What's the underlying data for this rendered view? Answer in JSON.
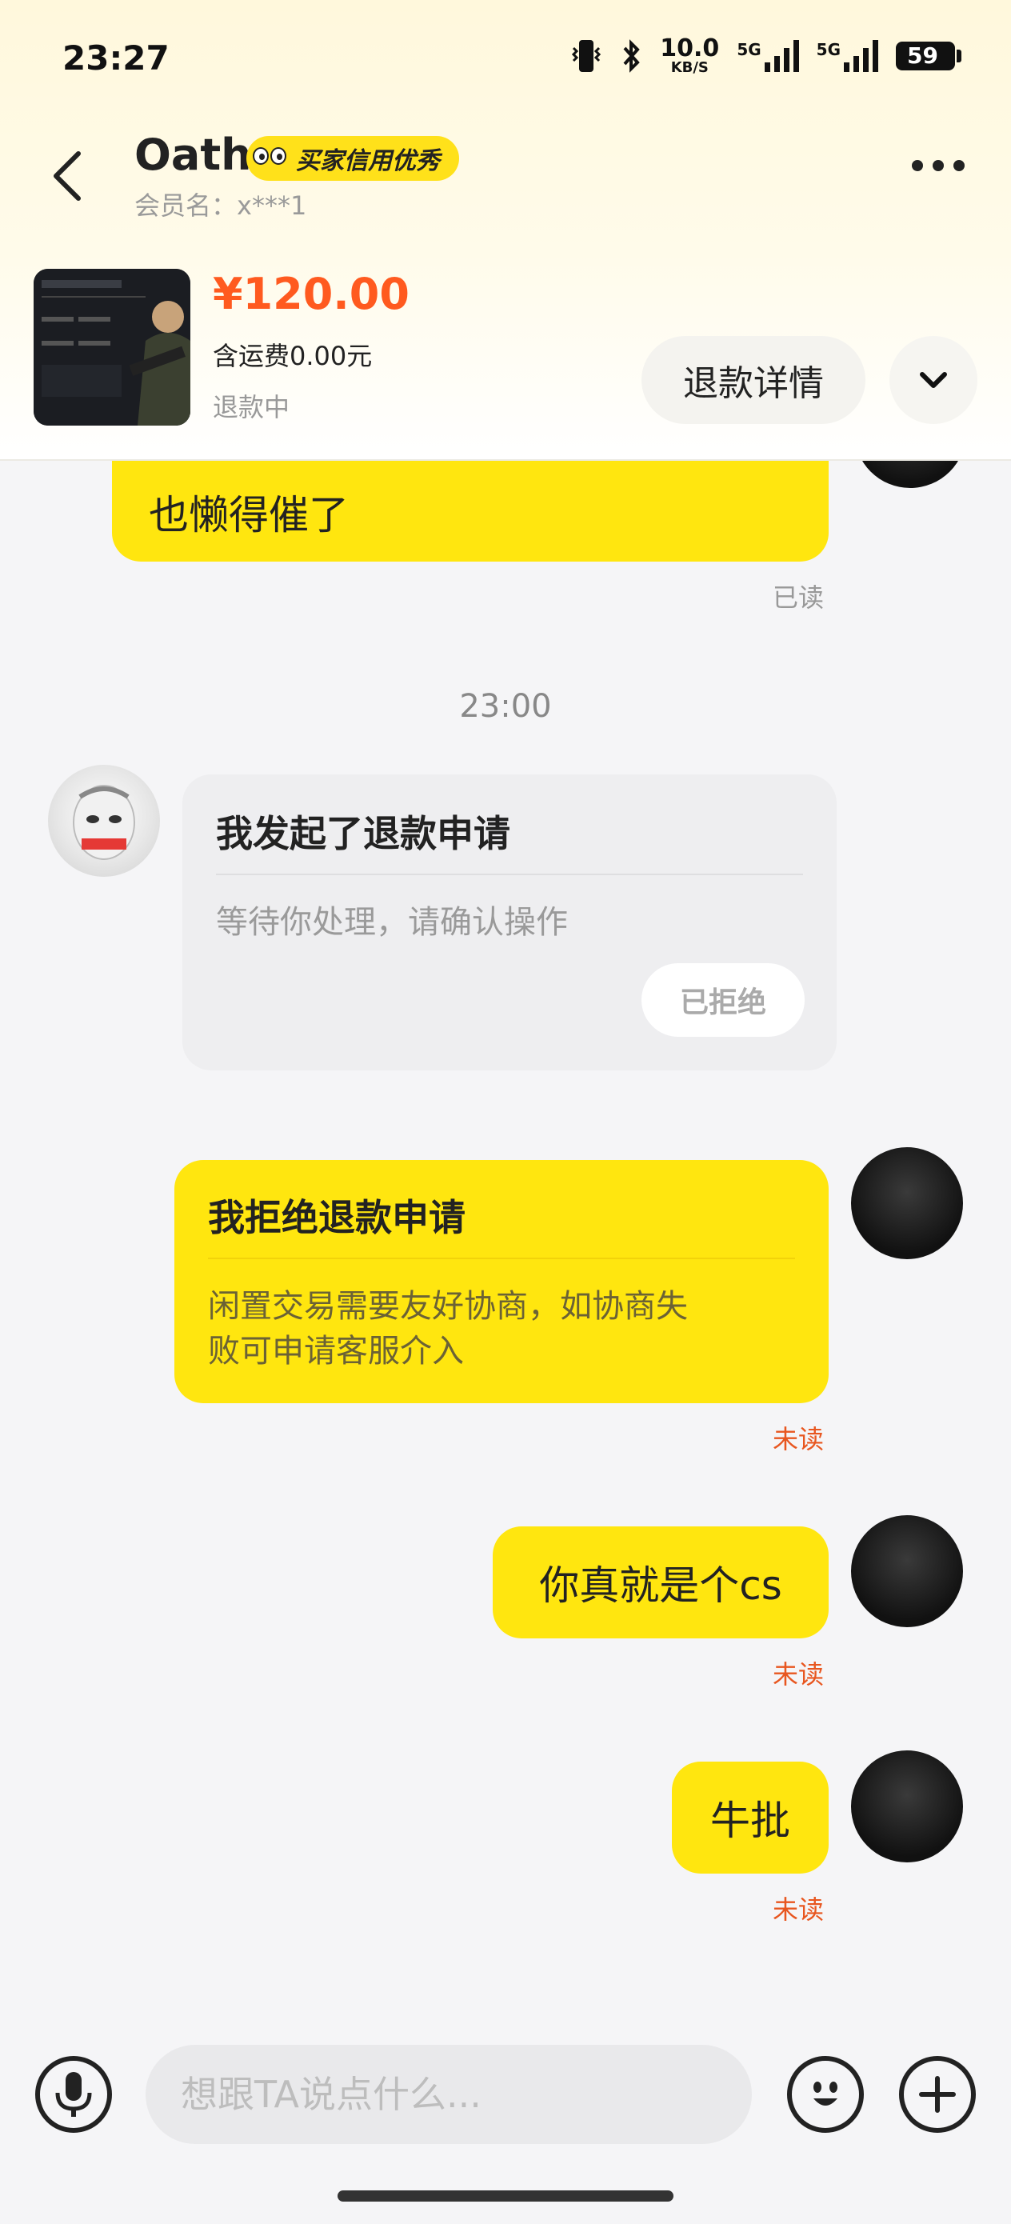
{
  "status_bar": {
    "time": "23:27",
    "speed_value": "10.0",
    "speed_unit": "KB/S",
    "net1": "5G",
    "net2": "5G",
    "battery": "59"
  },
  "header": {
    "name": "Oath",
    "badge": "买家信用优秀",
    "member": "会员名：x***1",
    "accent": "#ffe60f"
  },
  "product": {
    "price": "¥120.00",
    "shipping": "含运费0.00元",
    "status": "退款中",
    "refund_detail_label": "退款详情"
  },
  "chat": {
    "partial_message": "也懒得催了",
    "read_label": "已读",
    "time": "23:00",
    "refund_request": {
      "title": "我发起了退款申请",
      "subtitle": "等待你处理，请确认操作",
      "status": "已拒绝"
    },
    "reject_card": {
      "title": "我拒绝退款申请",
      "line1": "闲置交易需要友好协商，如协商失",
      "line2": "败可申请客服介入",
      "status": "未读"
    },
    "msg1": {
      "text": "你真就是个cs",
      "status": "未读"
    },
    "msg2": {
      "text": "牛批",
      "status": "未读"
    }
  },
  "input": {
    "placeholder": "想跟TA说点什么..."
  },
  "colors": {
    "bubble": "#ffe60f",
    "price": "#ff5a1f",
    "unread": "#e8561f"
  }
}
